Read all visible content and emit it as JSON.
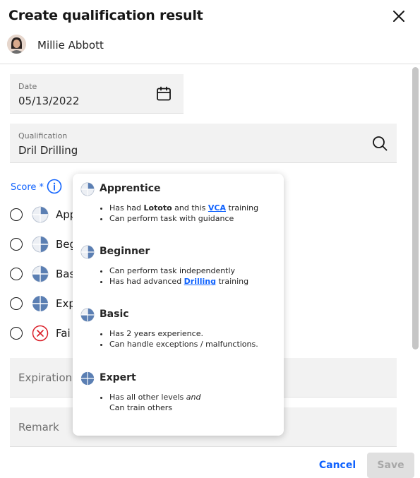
{
  "dialog": {
    "title": "Create qualification result",
    "user_name": "Millie Abbott"
  },
  "form": {
    "date": {
      "label": "Date",
      "value": "05/13/2022"
    },
    "qualification": {
      "label": "Qualification",
      "value": "Dril Drilling"
    },
    "score": {
      "label": "Score *",
      "options": [
        {
          "label": "Apprentice",
          "visible_text": "App",
          "icon": "quarter-circle-icon"
        },
        {
          "label": "Beginner",
          "visible_text": "Beg",
          "icon": "half-circle-icon"
        },
        {
          "label": "Basic",
          "visible_text": "Bas",
          "icon": "three-quarter-circle-icon"
        },
        {
          "label": "Expert",
          "visible_text": "Exp",
          "icon": "full-circle-icon"
        },
        {
          "label": "Failed",
          "visible_text": "Fai",
          "icon": "fail-icon"
        }
      ]
    },
    "expiration": {
      "placeholder": "Expiration"
    },
    "remark": {
      "placeholder": "Remark"
    }
  },
  "popover": {
    "levels": [
      {
        "name": "Apprentice",
        "bullets": [
          {
            "parts": [
              "Has had ",
              "Lototo",
              " and this ",
              "VCA",
              " training"
            ]
          },
          {
            "text": "Can perform task with guidance"
          }
        ]
      },
      {
        "name": "Beginner",
        "bullets": [
          {
            "text": "Can perform task independently"
          },
          {
            "parts": [
              "Has had advanced ",
              "Drilling",
              " training"
            ]
          }
        ]
      },
      {
        "name": "Basic",
        "bullets": [
          {
            "text": "Has 2 years experience."
          },
          {
            "text": "Can handle exceptions / malfunctions."
          }
        ]
      },
      {
        "name": "Expert",
        "bullets": [
          {
            "parts": [
              "Has all other levels ",
              "and"
            ]
          },
          {
            "text": "Can train others"
          }
        ]
      }
    ]
  },
  "footer": {
    "cancel_label": "Cancel",
    "save_label": "Save"
  },
  "colors": {
    "accent": "#0f62fe",
    "level_fill": "#5b7fb3",
    "fail": "#da1e28",
    "field_bg": "#f2f2f2"
  }
}
